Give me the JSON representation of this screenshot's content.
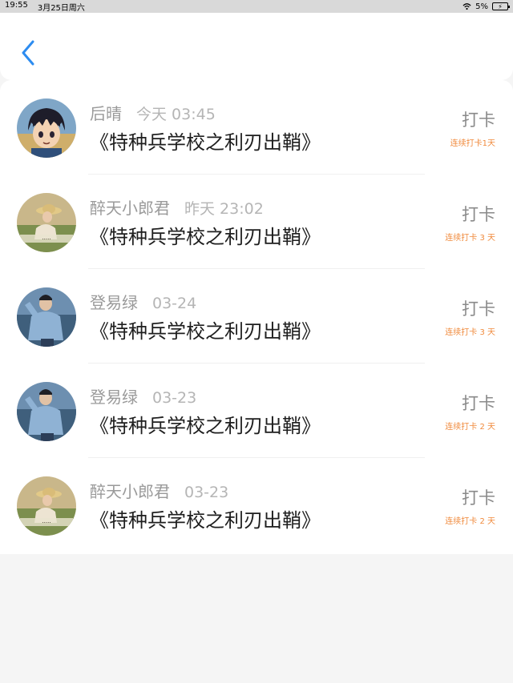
{
  "status_bar": {
    "time": "19:55",
    "date": "3月25日周六",
    "battery": "5%"
  },
  "nav": {
    "back_icon": "chevron-left-icon",
    "accent_color": "#2d8cf0"
  },
  "entries": [
    {
      "name": "后晴",
      "time": "今天 03:45",
      "title": "《特种兵学校之利刃出鞘》",
      "action": "打卡",
      "streak": "连续打卡1天",
      "avatar": "anime-boy"
    },
    {
      "name": "醉天小郎君",
      "time": "昨天 23:02",
      "title": "《特种兵学校之利刃出鞘》",
      "action": "打卡",
      "streak": "连续打卡 3 天",
      "avatar": "girl-hat"
    },
    {
      "name": "登易绿",
      "time": "03-24",
      "title": "《特种兵学校之利刃出鞘》",
      "action": "打卡",
      "streak": "连续打卡 3 天",
      "avatar": "man-denim"
    },
    {
      "name": "登易绿",
      "time": "03-23",
      "title": "《特种兵学校之利刃出鞘》",
      "action": "打卡",
      "streak": "连续打卡 2 天",
      "avatar": "man-denim"
    },
    {
      "name": "醉天小郎君",
      "time": "03-23",
      "title": "《特种兵学校之利刃出鞘》",
      "action": "打卡",
      "streak": "连续打卡 2 天",
      "avatar": "girl-hat"
    }
  ]
}
